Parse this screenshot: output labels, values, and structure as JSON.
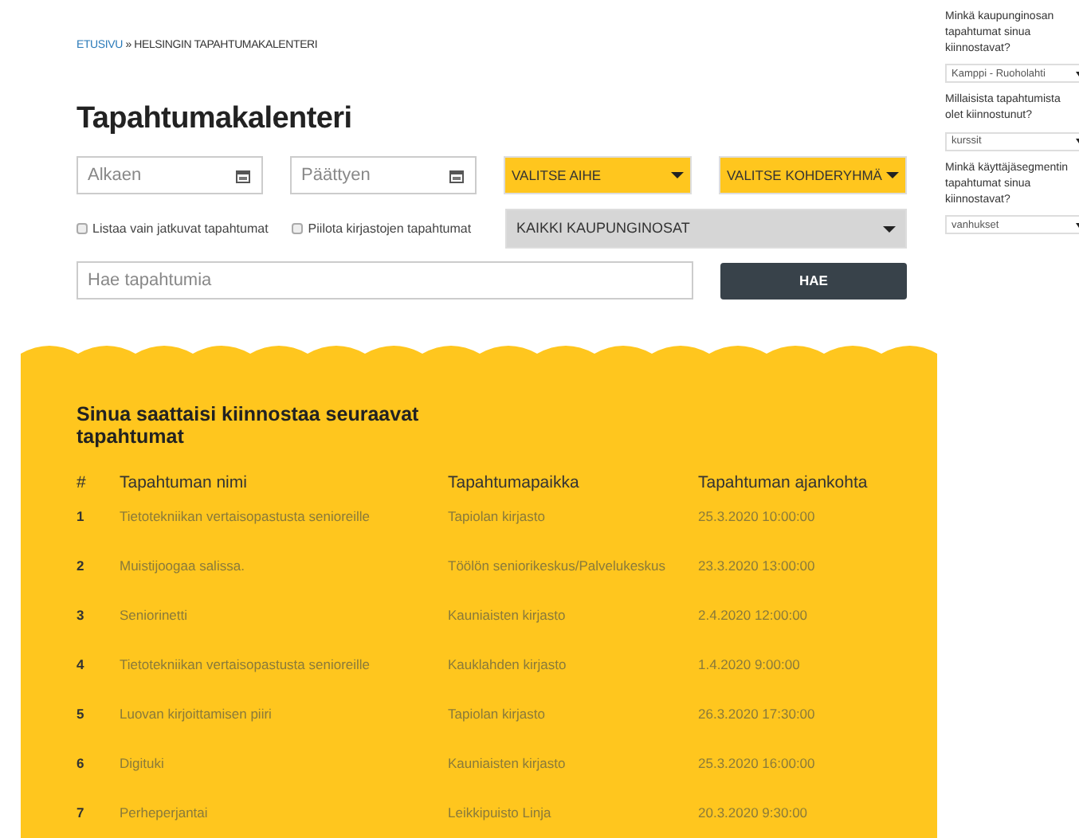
{
  "breadcrumb": {
    "home": "ETUSIVU",
    "separator": "»",
    "current": "HELSINGIN TAPAHTUMAKALENTERI"
  },
  "title": "Tapahtumakalenteri",
  "filters": {
    "start_date": {
      "placeholder": "Alkaen"
    },
    "end_date": {
      "placeholder": "Päättyen"
    },
    "topic_select": "VALITSE AIHE",
    "group_select": "VALITSE KOHDERYHMÄ",
    "checkboxes": [
      {
        "label": "Listaa vain jatkuvat tapahtumat",
        "checked": false
      },
      {
        "label": "Piilota kirjastojen tapahtumat",
        "checked": false
      }
    ],
    "district_select": "KAIKKI KAUPUNGINOSAT",
    "search": {
      "placeholder": "Hae tapahtumia"
    },
    "search_button": "HAE"
  },
  "recommendations": {
    "heading": "Sinua saattaisi kiinnostaa seuraavat tapahtumat",
    "columns": [
      "#",
      "Tapahtuman nimi",
      "Tapahtumapaikka",
      "Tapahtuman ajankohta"
    ],
    "rows": [
      [
        "1",
        "Tietotekniikan vertaisopastusta senioreille",
        "Tapiolan kirjasto",
        "25.3.2020 10:00:00"
      ],
      [
        "2",
        "Muistijoogaa salissa.",
        "Töölön seniorikeskus/Palvelukeskus",
        "23.3.2020 13:00:00"
      ],
      [
        "3",
        "Seniorinetti",
        "Kauniaisten kirjasto",
        "2.4.2020 12:00:00"
      ],
      [
        "4",
        "Tietotekniikan vertaisopastusta senioreille",
        "Kauklahden kirjasto",
        "1.4.2020 9:00:00"
      ],
      [
        "5",
        "Luovan kirjoittamisen piiri",
        "Tapiolan kirjasto",
        "26.3.2020 17:30:00"
      ],
      [
        "6",
        "Digituki",
        "Kauniaisten kirjasto",
        "25.3.2020 16:00:00"
      ],
      [
        "7",
        "Perheperjantai",
        "Leikkipuisto Linja",
        "20.3.2020 9:30:00"
      ]
    ]
  },
  "sidebar": [
    {
      "question": "Minkä kaupunginosan tapahtumat sinua kiinnostavat?",
      "value": "Kamppi - Ruoholahti"
    },
    {
      "question": "Millaisista tapahtumista olet kiinnostunut?",
      "value": "kurssit"
    },
    {
      "question": "Minkä käyttäjäsegmentin tapahtumat sinua kiinnostavat?",
      "value": "vanhukset"
    }
  ]
}
